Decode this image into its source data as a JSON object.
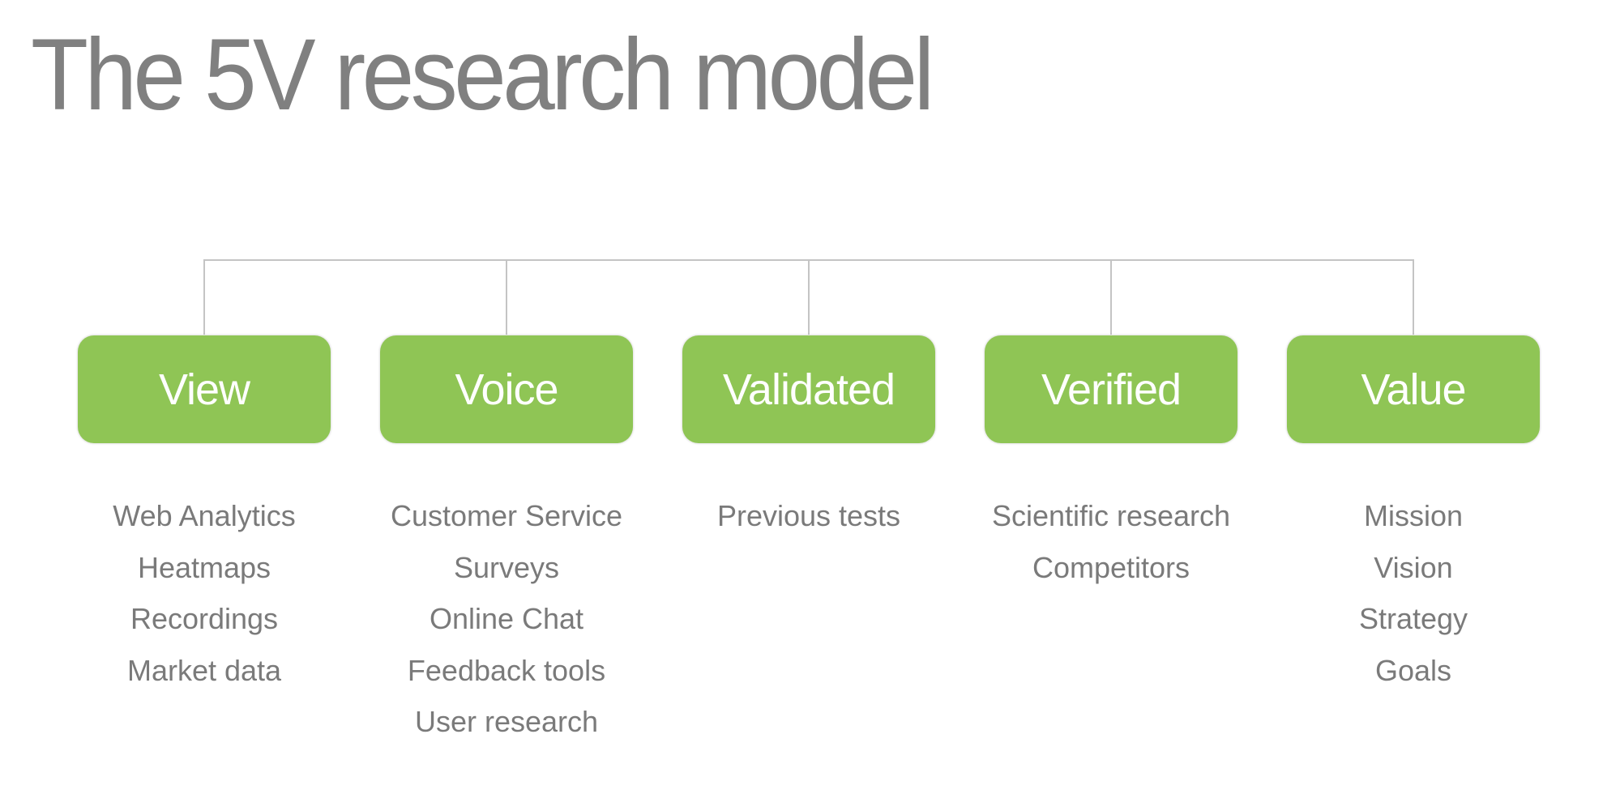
{
  "title": "The 5V research model",
  "colors": {
    "node_fill": "#8fc555",
    "node_text": "#ffffff",
    "item_text": "#7a7a7a",
    "connector": "#c4c4c4",
    "title": "#808080"
  },
  "nodes": [
    {
      "label": "View",
      "items": [
        "Web Analytics",
        "Heatmaps",
        "Recordings",
        "Market data"
      ]
    },
    {
      "label": "Voice",
      "items": [
        "Customer Service",
        "Surveys",
        "Online Chat",
        "Feedback tools",
        "User research"
      ]
    },
    {
      "label": "Validated",
      "items": [
        "Previous tests"
      ]
    },
    {
      "label": "Verified",
      "items": [
        "Scientific research",
        "Competitors"
      ]
    },
    {
      "label": "Value",
      "items": [
        "Mission",
        "Vision",
        "Strategy",
        "Goals"
      ]
    }
  ]
}
